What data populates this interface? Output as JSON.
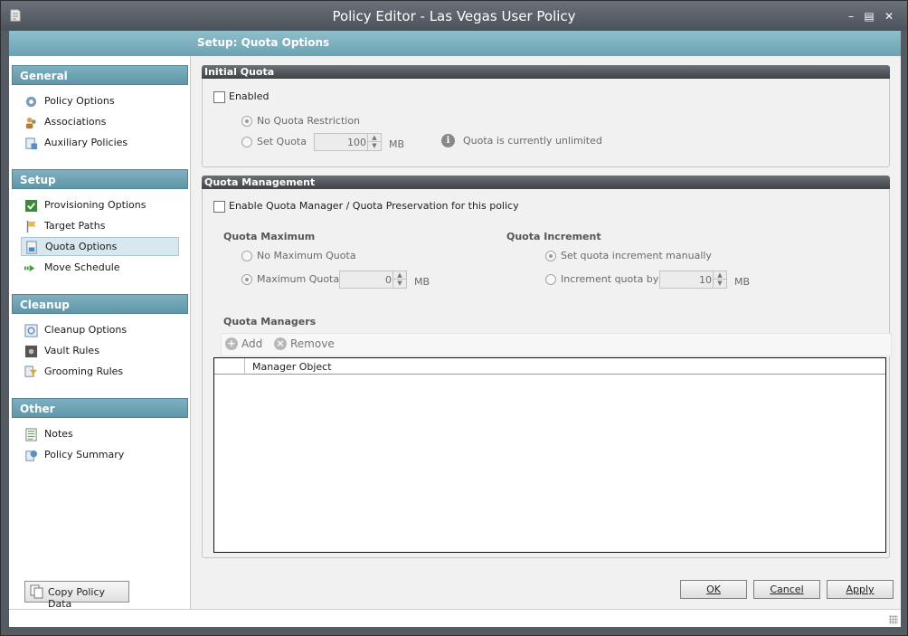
{
  "window": {
    "title": "Policy Editor - Las Vegas User Policy"
  },
  "header": {
    "title": "Setup: Quota Options"
  },
  "sidebar": {
    "groups": [
      {
        "title": "General",
        "items": [
          {
            "label": "Policy Options",
            "icon": "gear-icon"
          },
          {
            "label": "Associations",
            "icon": "users-icon"
          },
          {
            "label": "Auxiliary Policies",
            "icon": "policy-doc-icon"
          }
        ]
      },
      {
        "title": "Setup",
        "items": [
          {
            "label": "Provisioning Options",
            "icon": "green-check-icon"
          },
          {
            "label": "Target Paths",
            "icon": "target-flag-icon"
          },
          {
            "label": "Quota Options",
            "icon": "quota-doc-icon"
          },
          {
            "label": "Move Schedule",
            "icon": "move-arrow-icon"
          }
        ]
      },
      {
        "title": "Cleanup",
        "items": [
          {
            "label": "Cleanup Options",
            "icon": "cleanup-icon"
          },
          {
            "label": "Vault Rules",
            "icon": "vault-icon"
          },
          {
            "label": "Grooming Rules",
            "icon": "filter-icon"
          }
        ]
      },
      {
        "title": "Other",
        "items": [
          {
            "label": "Notes",
            "icon": "notes-icon"
          },
          {
            "label": "Policy Summary",
            "icon": "summary-icon"
          }
        ]
      }
    ],
    "selected": "Quota Options",
    "copy_button": "Copy Policy Data"
  },
  "initial_quota": {
    "title": "Initial Quota",
    "enabled_label": "Enabled",
    "enabled": false,
    "no_restriction_label": "No Quota Restriction",
    "no_restriction_selected": true,
    "set_quota_label": "Set Quota",
    "set_quota_value": "100",
    "unit": "MB",
    "info": "Quota is currently unlimited"
  },
  "quota_management": {
    "title": "Quota Management",
    "enable_label": "Enable Quota Manager / Quota Preservation for this policy",
    "enabled": false,
    "maximum": {
      "title": "Quota Maximum",
      "no_max_label": "No Maximum Quota",
      "max_label": "Maximum Quota",
      "max_selected": true,
      "value": "0",
      "unit": "MB"
    },
    "increment": {
      "title": "Quota Increment",
      "manual_label": "Set quota increment manually",
      "manual_selected": true,
      "by_label": "Increment quota by",
      "value": "10",
      "unit": "MB"
    },
    "managers": {
      "title": "Quota Managers",
      "add_label": "Add",
      "remove_label": "Remove",
      "column": "Manager Object"
    }
  },
  "buttons": {
    "ok": "OK",
    "cancel": "Cancel",
    "apply": "Apply"
  }
}
